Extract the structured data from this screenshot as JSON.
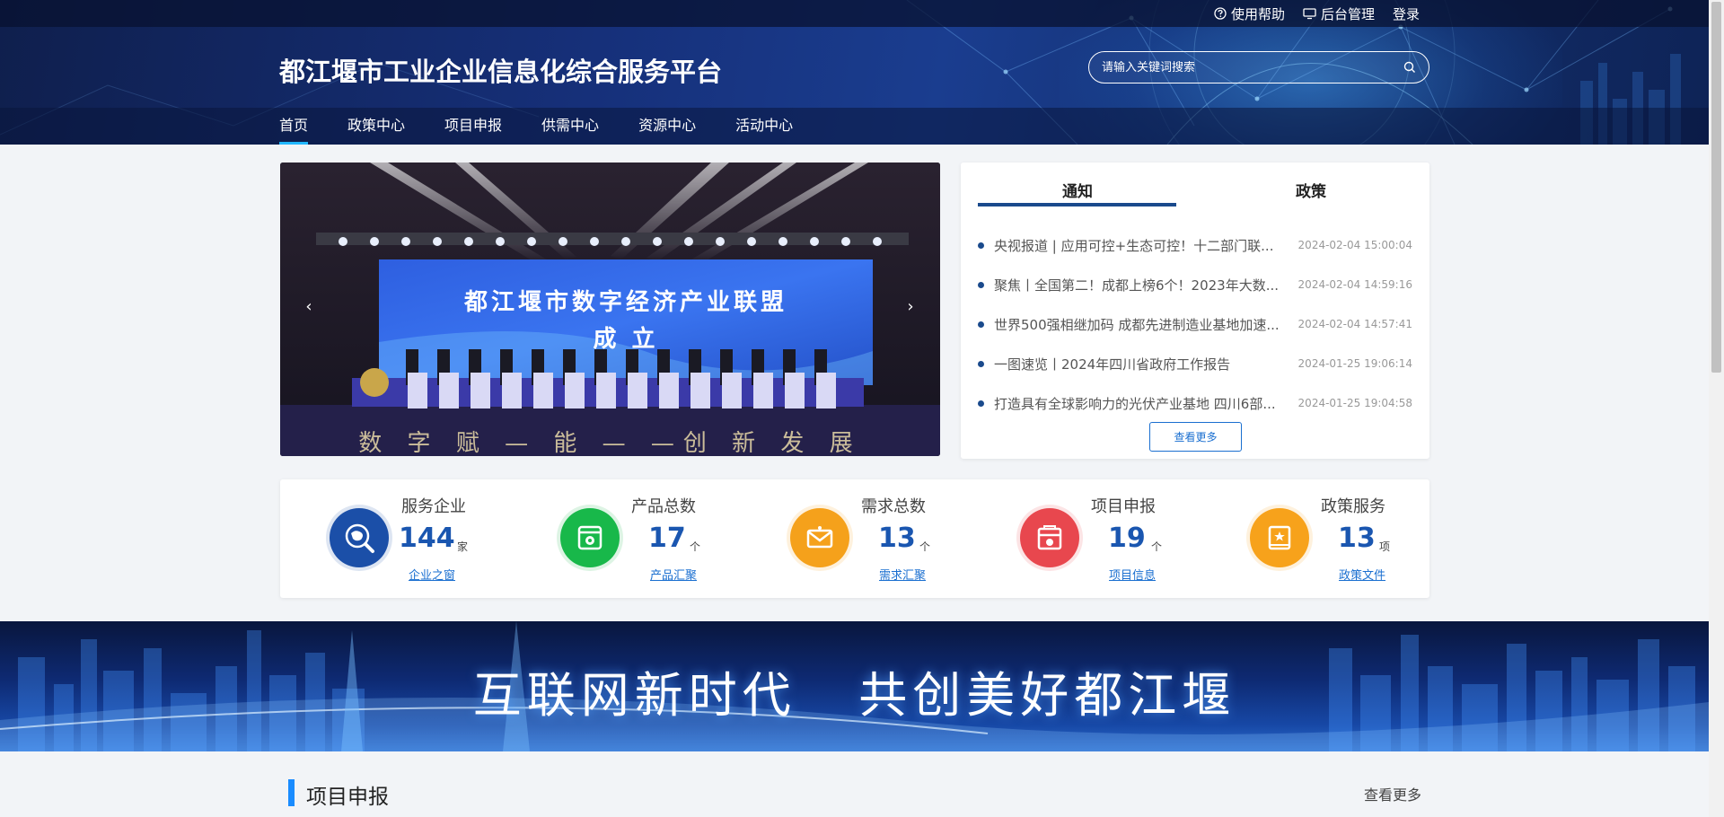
{
  "topbar": {
    "help_label": "使用帮助",
    "admin_label": "后台管理",
    "login_label": "登录"
  },
  "header": {
    "site_title": "都江堰市工业企业信息化综合服务平台",
    "search_placeholder": "请输入关键词搜索"
  },
  "nav": {
    "items": [
      {
        "label": "首页",
        "active": true
      },
      {
        "label": "政策中心"
      },
      {
        "label": "项目申报"
      },
      {
        "label": "供需中心"
      },
      {
        "label": "资源中心"
      },
      {
        "label": "活动中心"
      }
    ]
  },
  "carousel": {
    "screen_title_line1": "都江堰市数字经济产业联盟",
    "screen_title_line2": "成  立",
    "stage_caption": "数 字 赋 — 能 — —创 新 发 展",
    "prev_symbol": "‹",
    "next_symbol": "›"
  },
  "notice": {
    "tabs": [
      "通知",
      "政策"
    ],
    "active_tab": "通知",
    "items": [
      {
        "title": "央视报道 | 应用可控+生态可控！十二部门联...",
        "date": "2024-02-04 15:00:04"
      },
      {
        "title": "聚焦丨全国第二！成都上榜6个！2023年大数...",
        "date": "2024-02-04 14:59:16"
      },
      {
        "title": "世界500强相继加码 成都先进制造业基地加速...",
        "date": "2024-02-04 14:57:41"
      },
      {
        "title": "一图速览丨2024年四川省政府工作报告",
        "date": "2024-01-25 19:06:14"
      },
      {
        "title": "打造具有全球影响力的光伏产业基地 四川6部...",
        "date": "2024-01-25 19:04:58"
      }
    ],
    "more_label": "查看更多"
  },
  "stats": [
    {
      "label": "服务企业",
      "value": "144",
      "unit": "家",
      "link": "企业之窗",
      "icon": "globe-search-icon",
      "color": "#1b4fa8"
    },
    {
      "label": "产品总数",
      "value": "17",
      "unit": "个",
      "link": "产品汇聚",
      "icon": "product-box-icon",
      "color": "#18b84a"
    },
    {
      "label": "需求总数",
      "value": "13",
      "unit": "个",
      "link": "需求汇聚",
      "icon": "envelope-icon",
      "color": "#f5a11b"
    },
    {
      "label": "项目申报",
      "value": "19",
      "unit": "个",
      "link": "项目信息",
      "icon": "project-folder-icon",
      "color": "#e8474e"
    },
    {
      "label": "政策服务",
      "value": "13",
      "unit": "项",
      "link": "政策文件",
      "icon": "policy-book-icon",
      "color": "#f7a21b"
    }
  ],
  "slogan": {
    "text": "互联网新时代   共创美好都江堰"
  },
  "section": {
    "title": "项目申报",
    "more_label": "查看更多"
  }
}
